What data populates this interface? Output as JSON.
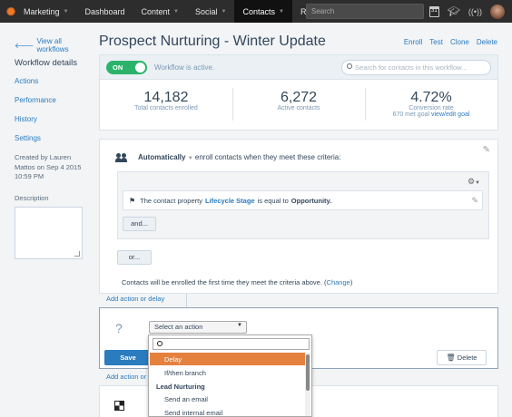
{
  "topnav": {
    "app_label": "Marketing",
    "items": [
      {
        "label": "Dashboard",
        "caret": false
      },
      {
        "label": "Content",
        "caret": true
      },
      {
        "label": "Social",
        "caret": true
      },
      {
        "label": "Contacts",
        "caret": true,
        "active": true
      },
      {
        "label": "Reports",
        "caret": true
      }
    ],
    "search_placeholder": "Search",
    "calendar_day": "31",
    "icons": [
      "calendar-icon",
      "graduation-cap-icon",
      "broadcast-icon",
      "user-avatar"
    ]
  },
  "sidebar": {
    "back_link": "View all workflows",
    "title": "Workflow details",
    "links": [
      "Actions",
      "Performance",
      "History",
      "Settings"
    ],
    "created": "Created by Lauren Mattos on Sep 4 2015 10:59 PM",
    "description_label": "Description",
    "description_value": ""
  },
  "header": {
    "title": "Prospect Nurturing - Winter Update",
    "actions": [
      "Enroll",
      "Test",
      "Clone",
      "Delete"
    ]
  },
  "status": {
    "toggle_label": "ON",
    "toggle_on": true,
    "status_text": "Workflow is active.",
    "search_placeholder": "Search for contacts in this workflow..."
  },
  "stats": [
    {
      "value": "14,182",
      "label": "Total contacts enrolled"
    },
    {
      "value": "6,272",
      "label": "Active contacts"
    },
    {
      "value": "4.72%",
      "label": "Conversion rate",
      "sub": "670 met goal",
      "sub_link": "view/edit goal"
    }
  ],
  "enrollment": {
    "trigger_bold": "Automatically",
    "trigger_rest": "enroll contacts when they meet these criteria:",
    "filter": {
      "prefix": "The contact property",
      "property": "Lifecycle Stage",
      "operator": "is equal to",
      "value": "Opportunity."
    },
    "and_label": "and...",
    "or_label": "or...",
    "note": "Contacts will be enrolled the first time they meet the criteria above.",
    "change_open": "(",
    "change_link": "Change",
    "change_close": ")"
  },
  "add_action_label": "Add action or delay",
  "action_editor": {
    "question": "?",
    "select_value": "Select an action",
    "save_label": "Save",
    "delete_label": "Delete"
  },
  "dropdown": {
    "items": [
      {
        "label": "Delay",
        "highlight": true
      },
      {
        "label": "If/then branch"
      }
    ],
    "group_label": "Lead Nurturing",
    "group_items": [
      "Send an email",
      "Send internal email"
    ]
  },
  "colors": {
    "accent_blue": "#2b7bbf",
    "toggle_green": "#2bb36b",
    "highlight_orange": "#e4813f",
    "nav_bg": "#2d2d2d"
  }
}
